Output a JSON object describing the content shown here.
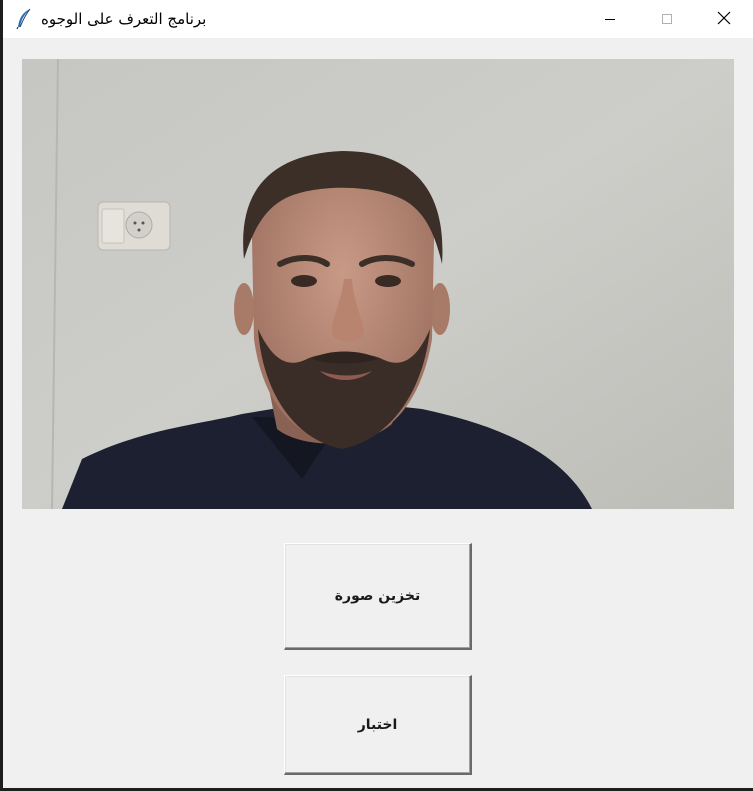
{
  "window": {
    "title": "برنامج التعرف على الوجوه",
    "app_icon": "feather-icon",
    "controls": {
      "minimize_icon": "minimize-icon",
      "maximize_icon": "maximize-icon",
      "close_icon": "close-icon"
    }
  },
  "camera": {
    "content": "webcam-frame"
  },
  "buttons": {
    "save_image_label": "تخزين صورة",
    "test_label": "اختبار"
  },
  "colors": {
    "window_bg": "#f0f0f0",
    "titlebar_bg": "#ffffff",
    "wall": "#c9c9c5",
    "shirt": "#1c2030",
    "skin": "#b88a76"
  }
}
